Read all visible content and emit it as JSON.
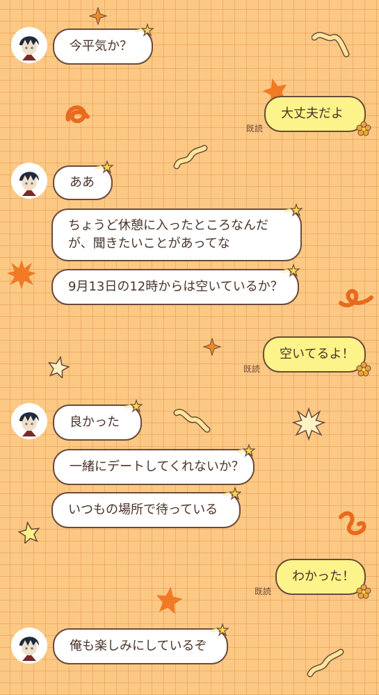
{
  "colors": {
    "background": "#fcc985",
    "grid": "#e29650",
    "bubble_other": "#ffffff",
    "bubble_me": "#fcf48a",
    "outline": "#6b4a3a"
  },
  "messages": [
    {
      "text": "今平気か？"
    },
    {
      "text": "大丈夫だよ",
      "read": "既読"
    },
    {
      "text": "ああ"
    },
    {
      "text": "ちょうど休憩に入ったところなんだが、聞きたいことがあってな"
    },
    {
      "text": "9月13日の12時からは空いているか？"
    },
    {
      "text": "空いてるよ！",
      "read": "既読"
    },
    {
      "text": "良かった"
    },
    {
      "text": "一緒にデートしてくれないか？"
    },
    {
      "text": "いつもの場所で待っている"
    },
    {
      "text": "わかった！",
      "read": "既読"
    },
    {
      "text": "俺も楽しみにしているぞ"
    }
  ],
  "icons": [
    "avatar",
    "star-badge-icon",
    "flower-badge-icon",
    "sparkle-icon",
    "squiggle-icon",
    "star-icon",
    "burst-icon"
  ]
}
